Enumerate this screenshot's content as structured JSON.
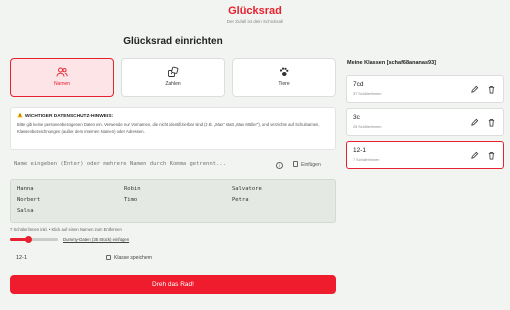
{
  "header": {
    "brand": "Glücksrad",
    "tagline": "Der Zufall ist dein Schicksal!"
  },
  "setup": {
    "title": "Glücksrad einrichten",
    "modes": [
      {
        "label": "Namen",
        "icon": "users-icon",
        "active": true
      },
      {
        "label": "Zahlen",
        "icon": "dice-icon",
        "active": false
      },
      {
        "label": "Tiere",
        "icon": "paw-icon",
        "active": false
      }
    ]
  },
  "privacy_notice": {
    "title": "WICHTIGER DATENSCHUTZ-HINWEIS:",
    "body": "Bitte gib keine personenbezogenen Daten ein. Verwende nur Vornamen, die nicht identifizierbar sind (z.B. „Max\" statt „Max Müller\"), und verzichte auf Schulnamen, Klassenbezeichnungen (außer dem internen Namen) oder Adressen."
  },
  "name_input": {
    "placeholder": "Name eingeben (Enter) oder mehrere Namen durch Komma getrennt...",
    "paste_label": "Einfügen"
  },
  "names": [
    "Hanna",
    "Robin",
    "Salvatore",
    "Norbert",
    "Timo",
    "Petra",
    "Salsa"
  ],
  "hint": "7 Schüler/innen inkl. • Klick auf einen Namen zum Entfernen",
  "slider": {
    "value_fraction": 0.35
  },
  "dummy_link": "Dummy-Daten (35 Stück) einfügen",
  "class_field": {
    "value": "12-1",
    "save_label": "Klasse speichern"
  },
  "spin_button": "Dreh das Rad!",
  "sidebar": {
    "title": "Meine Klassen [schaf68ananas93]",
    "classes": [
      {
        "name": "7cd",
        "count": "37 Schüler/innen",
        "active": false
      },
      {
        "name": "3c",
        "count": "25 Schüler/innen",
        "active": false
      },
      {
        "name": "12-1",
        "count": "7 Schüler/innen",
        "active": true
      }
    ]
  },
  "colors": {
    "accent": "#e8202f",
    "active_tab_bg": "#fde4e6",
    "background": "#f1f4f0"
  }
}
